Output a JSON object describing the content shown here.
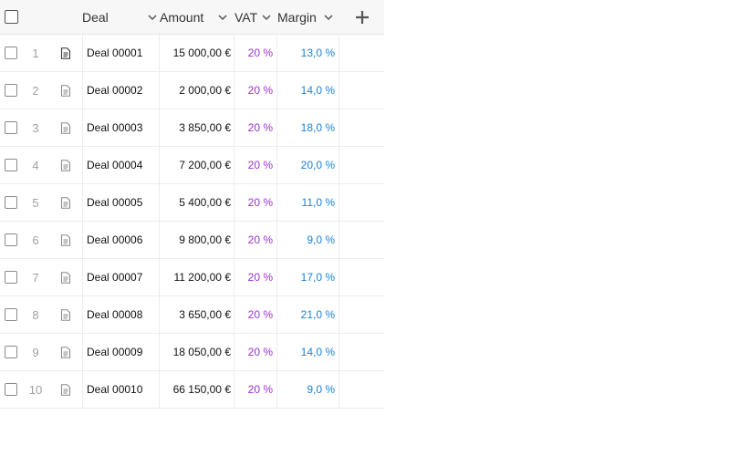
{
  "header": {
    "columns": [
      {
        "label": "Deal"
      },
      {
        "label": "Amount"
      },
      {
        "label": "VAT"
      },
      {
        "label": "Margin"
      }
    ]
  },
  "rows": [
    {
      "num": "1",
      "deal": "Deal 00001",
      "amount": "15 000,00 €",
      "vat": "20 %",
      "margin": "13,0 %"
    },
    {
      "num": "2",
      "deal": "Deal 00002",
      "amount": "2 000,00 €",
      "vat": "20 %",
      "margin": "14,0 %"
    },
    {
      "num": "3",
      "deal": "Deal 00003",
      "amount": "3 850,00 €",
      "vat": "20 %",
      "margin": "18,0 %"
    },
    {
      "num": "4",
      "deal": "Deal 00004",
      "amount": "7 200,00 €",
      "vat": "20 %",
      "margin": "20,0 %"
    },
    {
      "num": "5",
      "deal": "Deal 00005",
      "amount": "5 400,00 €",
      "vat": "20 %",
      "margin": "11,0 %"
    },
    {
      "num": "6",
      "deal": "Deal 00006",
      "amount": "9 800,00 €",
      "vat": "20 %",
      "margin": "9,0 %"
    },
    {
      "num": "7",
      "deal": "Deal 00007",
      "amount": "11 200,00 €",
      "vat": "20 %",
      "margin": "17,0 %"
    },
    {
      "num": "8",
      "deal": "Deal 00008",
      "amount": "3 650,00 €",
      "vat": "20 %",
      "margin": "21,0 %"
    },
    {
      "num": "9",
      "deal": "Deal 00009",
      "amount": "18 050,00 €",
      "vat": "20 %",
      "margin": "14,0 %"
    },
    {
      "num": "10",
      "deal": "Deal 00010",
      "amount": "66 150,00 €",
      "vat": "20 %",
      "margin": "9,0 %"
    }
  ],
  "colors": {
    "vat": "#9b30d0",
    "margin": "#1a82d6",
    "header_bg": "#f7f7f7"
  },
  "icons": {
    "row_icon": "document-icon",
    "add_column": "plus-icon",
    "sort": "chevron-down-icon"
  }
}
